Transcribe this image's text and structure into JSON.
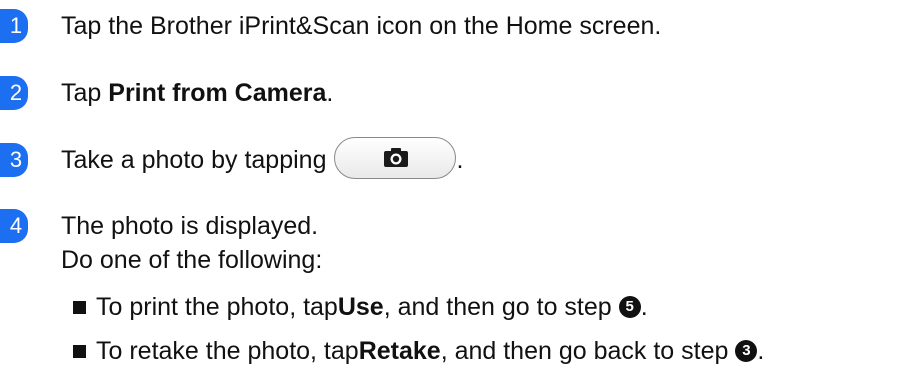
{
  "steps": [
    {
      "number": "1",
      "text": "Tap the Brother iPrint&Scan icon on the Home screen."
    },
    {
      "number": "2",
      "prefix": "Tap ",
      "bold": "Print from Camera",
      "suffix": "."
    },
    {
      "number": "3",
      "prefix": "Take a photo by tapping",
      "button_icon": "camera-icon",
      "suffix": "."
    },
    {
      "number": "4",
      "line1": "The photo is displayed.",
      "line2": "Do one of the following:"
    }
  ],
  "bullets": [
    {
      "prefix": "To print the photo, tap ",
      "bold": "Use",
      "middle": ", and then go to step ",
      "step_ref": "5",
      "suffix": "."
    },
    {
      "prefix": "To retake the photo, tap ",
      "bold": "Retake",
      "middle": ", and then go back to step ",
      "step_ref": "3",
      "suffix": "."
    }
  ],
  "colors": {
    "step_badge": "#1b6ff0",
    "text": "#111111"
  }
}
